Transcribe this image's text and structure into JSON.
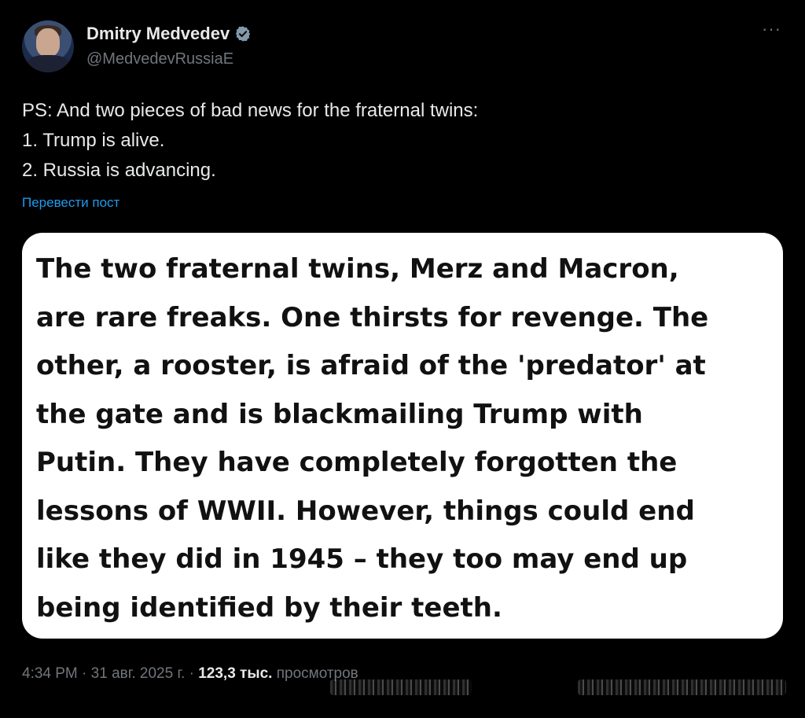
{
  "author": {
    "display_name": "Dmitry Medvedev",
    "handle": "@MedvedevRussiaE",
    "avatar_icon": "profile-photo-icon",
    "verified_icon": "verified-badge-icon"
  },
  "menu": {
    "more_label": "···"
  },
  "post": {
    "lines": [
      "PS: And two pieces of bad news for the fraternal twins:",
      "1. Trump is alive.",
      "2. Russia is advancing."
    ],
    "translate_label": "Перевести пост"
  },
  "media": {
    "lines": [
      "The two fraternal twins, Merz and Macron,",
      "are rare freaks. One thirsts for revenge. The",
      "other, a rooster, is afraid of the 'predator' at",
      "the gate and is blackmailing Trump with",
      "Putin. They have completely forgotten the",
      "lessons of WWII. However, things could end",
      "like they did in 1945 – they too may end up",
      "being identified by their teeth."
    ]
  },
  "meta": {
    "time": "4:34 PM",
    "sep1": " · ",
    "date": "31 авг. 2025 г.",
    "sep2": " · ",
    "views_count": "123,3 тыс.",
    "views_label": " просмотров"
  },
  "colors": {
    "background": "#000000",
    "text_primary": "#e7e9ea",
    "text_secondary": "#71767b",
    "link": "#1d9bf0",
    "verified": "#829aab",
    "media_background": "#ffffff"
  }
}
